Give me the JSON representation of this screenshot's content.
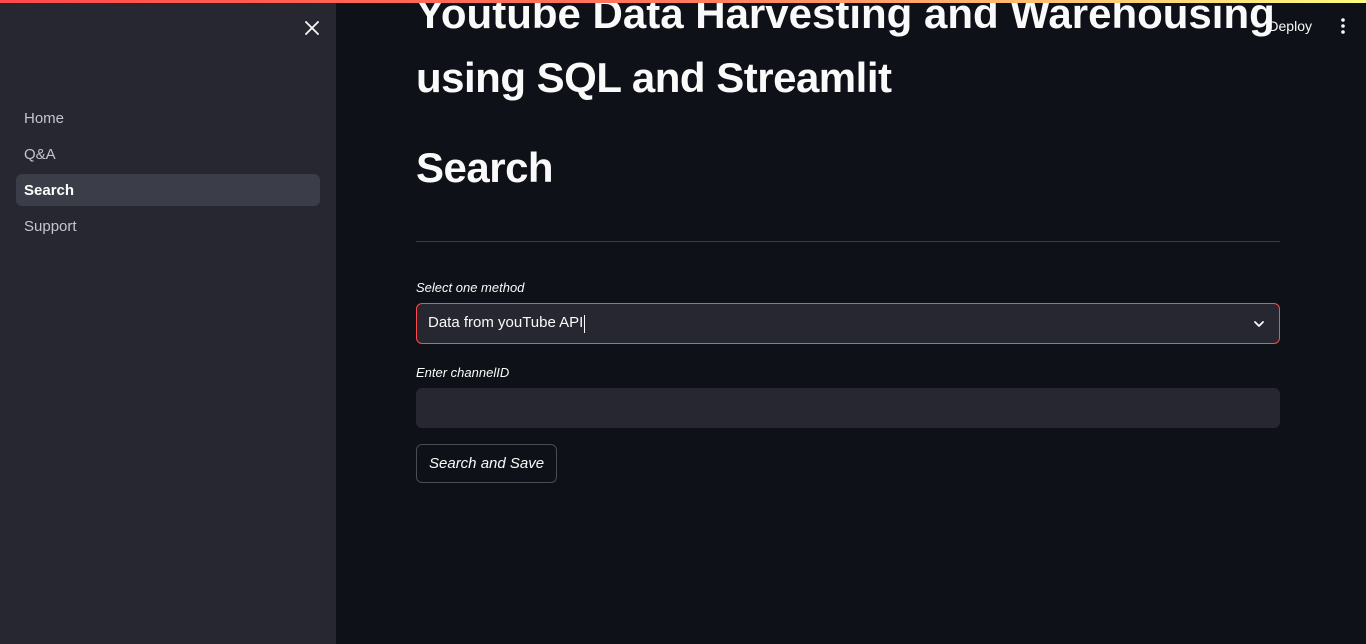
{
  "colors": {
    "accent": "#ff4b4b",
    "background": "#0e1117",
    "sidebar": "#262730"
  },
  "sidebar": {
    "close_icon": "close-icon",
    "items": [
      {
        "label": "Home",
        "active": false
      },
      {
        "label": "Q&A",
        "active": false
      },
      {
        "label": "Search",
        "active": true
      },
      {
        "label": "Support",
        "active": false
      }
    ]
  },
  "header": {
    "deploy_label": "Deploy",
    "menu_icon": "kebab-menu-icon"
  },
  "main": {
    "title_line_1": "Youtube Data Harvesting and Warehousing",
    "title_line_2": "using SQL and Streamlit",
    "page_heading": "Search",
    "method_label": "Select one method",
    "method_value": "Data from youTube API",
    "channel_label": "Enter channelID",
    "channel_value": "",
    "channel_placeholder": "",
    "button_label": "Search and Save"
  }
}
